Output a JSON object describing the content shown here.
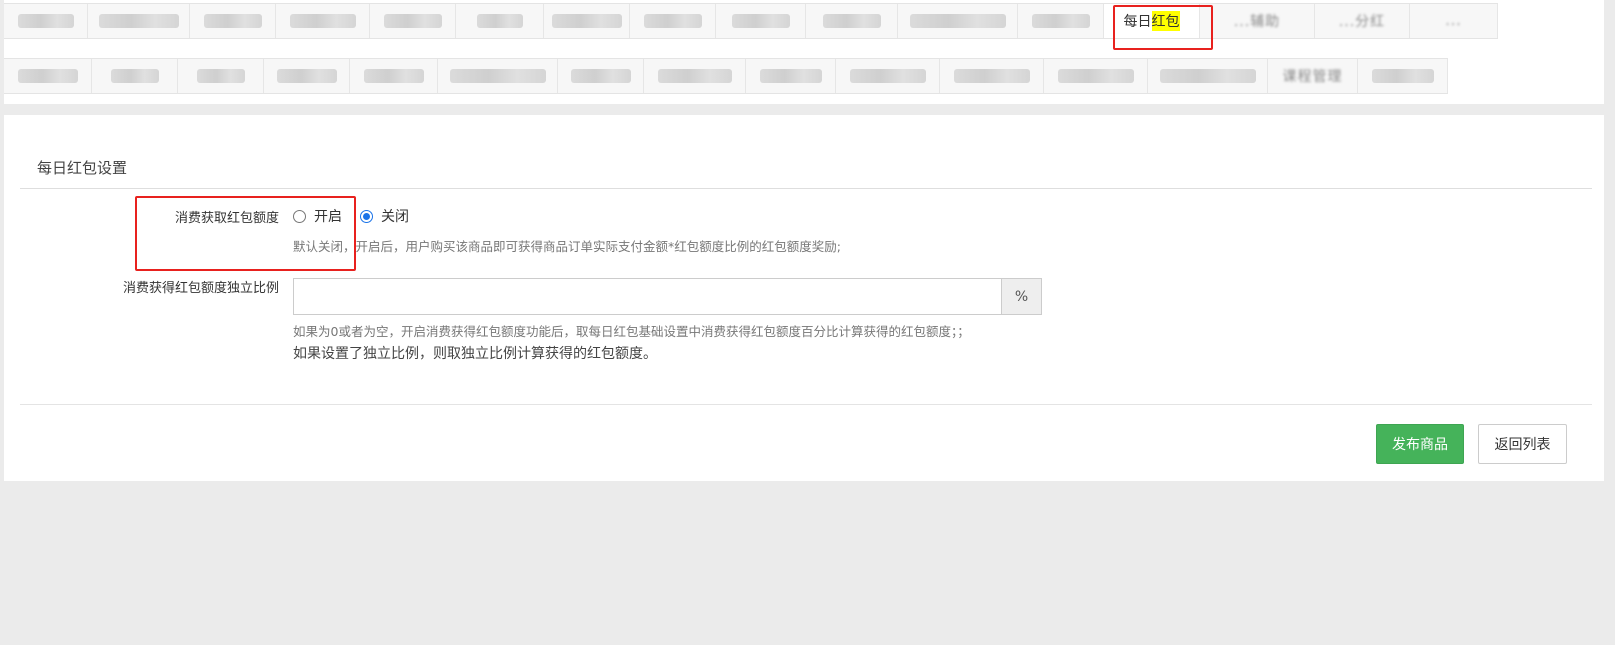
{
  "tabs_row1": [
    {
      "label": "",
      "active": false,
      "blur": true
    },
    {
      "label": "",
      "active": false,
      "blur": true
    },
    {
      "label": "",
      "active": false,
      "blur": true
    },
    {
      "label": "",
      "active": false,
      "blur": true
    },
    {
      "label": "",
      "active": false,
      "blur": true
    },
    {
      "label": "",
      "active": false,
      "blur": true
    },
    {
      "label": "",
      "active": false,
      "blur": true
    },
    {
      "label": "",
      "active": false,
      "blur": true
    },
    {
      "label": "",
      "active": false,
      "blur": true
    },
    {
      "label": "",
      "active": false,
      "blur": true
    },
    {
      "label": "",
      "active": false,
      "blur": true
    },
    {
      "label": "",
      "active": false,
      "blur": true
    },
    {
      "label_plain": "每日",
      "label_highlight": "红包",
      "active": true
    },
    {
      "label": "...辅助",
      "active": false,
      "faint": true
    },
    {
      "label": "...分红",
      "active": false,
      "faint": true
    },
    {
      "label": "...",
      "active": false,
      "faint": true
    }
  ],
  "tabs_row2": [
    {
      "label": "",
      "blur": true
    },
    {
      "label": "",
      "blur": true
    },
    {
      "label": "",
      "blur": true
    },
    {
      "label": "",
      "blur": true
    },
    {
      "label": "",
      "blur": true
    },
    {
      "label": "",
      "blur": true
    },
    {
      "label": "",
      "blur": true
    },
    {
      "label": "",
      "blur": true
    },
    {
      "label": "",
      "blur": true
    },
    {
      "label": "",
      "blur": true
    },
    {
      "label": "",
      "blur": true
    },
    {
      "label": "",
      "blur": true
    },
    {
      "label": "",
      "blur": true
    },
    {
      "label": "课程管理",
      "faint": true
    },
    {
      "label": "",
      "blur": true
    }
  ],
  "section": {
    "title": "每日红包设置"
  },
  "form": {
    "consume_label": "消费获取红包额度",
    "radio_on": "开启",
    "radio_off": "关闭",
    "selected": "off",
    "consume_hint": "默认关闭，开启后，用户购买该商品即可获得商品订单实际支付金额*红包额度比例的红包额度奖励;",
    "ratio_label": "消费获得红包额度独立比例",
    "ratio_value": "",
    "ratio_placeholder": "",
    "ratio_addon": "%",
    "ratio_hint1": "如果为0或者为空，开启消费获得红包额度功能后，取每日红包基础设置中消费获得红包额度百分比计算获得的红包额度；；",
    "ratio_hint2": "如果设置了独立比例，则取独立比例计算获得的红包额度。"
  },
  "buttons": {
    "publish": "发布商品",
    "back": "返回列表"
  },
  "colors": {
    "primary_button": "#45b35a",
    "radio_accent": "#1a73e8",
    "highlight_box": "#e8211e",
    "text_highlight": "#ffff00"
  }
}
